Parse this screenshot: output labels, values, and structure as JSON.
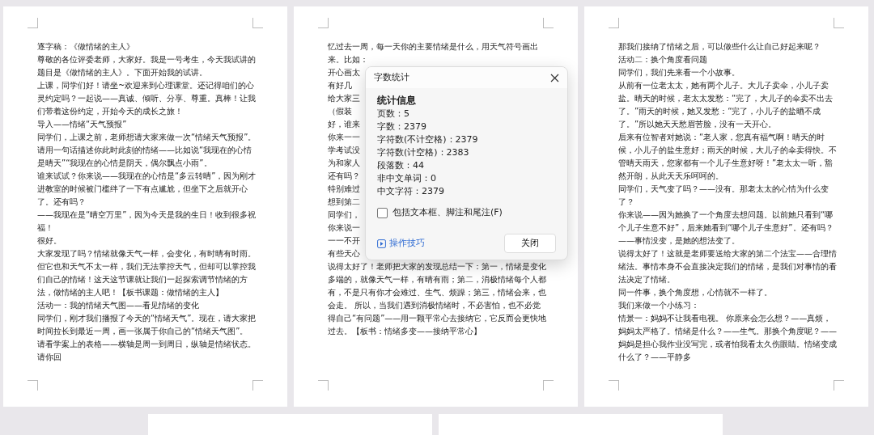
{
  "pages": [
    {
      "paragraphs": [
        "逐字稿：《做情绪的主人》",
        "尊敬的各位评委老师，大家好。我是一号考生，今天我试讲的题目是《做情绪的主人》。下面开始我的试讲。",
        "上课，同学们好！请坐~欢迎来到心理课堂。还记得咱们的心灵约定吗？一起说——真诚、倾听、分享、尊重。真棒！让我们带着这份约定，开始今天的成长之旅！",
        "导入——情绪“天气预报”",
        "同学们，上课之前，老师想请大家来做一次“情绪天气预报”。请用一句话描述你此时此刻的情绪——比如说“我现在的心情是晴天”“我现在的心情是阴天，偶尔飘点小雨”。",
        "谁来试试？你来说——我现在的心情是“多云转晴”，因为刚才进教室的时候被门槛绊了一下有点尴尬，但坐下之后就开心了。还有吗？",
        "——我现在是“晴空万里”，因为今天是我的生日！收到很多祝福！",
        "很好。",
        "大家发现了吗？情绪就像天气一样，会变化，有时晴有时雨。但它也和天气不太一样，我们无法掌控天气，但却可以掌控我们自己的情绪！这天这节课就让我们一起探索调节情绪的方法，做情绪的主人吧！【板书课题：做情绪的主人】",
        "活动一：我的情绪天气图——看见情绪的变化",
        "同学们，刚才我们播报了今天的“情绪天气”。现在，请大家把时间拉长到最近一周，画一张属于你自己的“情绪天气图”。",
        "请看学案上的表格——横轴是周一到周日，纵轴是情绪状态。请你回"
      ]
    },
    {
      "paragraphs_before": [
        "忆过去一周，每一天你的主要情绪是什么，用天气符号画出来。比如："
      ],
      "covered_lines": [
        "开心画太",
        "有好几",
        "给大家三",
        "（假装",
        "好，谁来",
        "你来一一",
        "学考试没",
        "为和家人",
        "还有吗？",
        "特别难过",
        "想到第二",
        "同学们，",
        "你来说一",
        "一一不开",
        "有些天心"
      ],
      "paragraphs": [
        "说得太好了！老师把大家的发现总结一下：第一，情绪是变化多端的，就像天气一样，有晴有雨；第二，消极情绪每个人都有，不是只有你才会难过、生气、烦躁；第三，情绪会来，也会走。 所以，当我们遇到消极情绪时，不必害怕，也不必觉得自己“有问题”——用一颗平常心去接纳它，它反而会更快地过去。【板书：情绪多变——接纳平常心】"
      ]
    },
    {
      "paragraphs": [
        "那我们接纳了情绪之后，可以做些什么让自己好起来呢？",
        "活动二：换个角度看问题",
        "同学们，我们先来看一个小故事。",
        "从前有一位老太太，她有两个儿子。大儿子卖伞，小儿子卖盐。晴天的时候，老太太发愁：“完了，大儿子的伞卖不出去了。”雨天的时候，她又发愁：“完了，小儿子的盐晒不成了。”所以她天天愁眉苦脸，没有一天开心。",
        "后来有位智者对她说：“老人家，您真有福气啊！晴天的时候，小儿子的盐生意好；雨天的时候，大儿子的伞卖得快。不管晴天雨天，您家都有一个儿子生意好呀！”老太太一听，豁然开朗，从此天天乐呵呵的。",
        "同学们，天气变了吗？——没有。那老太太的心情为什么变了？",
        "你来说——因为她换了一个角度去想问题。以前她只看到“哪个儿子生意不好”，后来她看到“哪个儿子生意好”。还有吗？——事情没变，是她的想法变了。",
        "说得太好了！这就是老师要送给大家的第二个法宝——合理情绪法。事情本身不会直接决定我们的情绪，是我们对事情的看法决定了情绪。",
        "同一件事，换个角度想，心情就不一样了。",
        "我们来做一个小练习：",
        "情景一：妈妈不让我看电视。 你原来会怎么想？——真烦，妈妈太严格了。情绪是什么？——生气。那换个角度呢？——妈妈是担心我作业没写完，或者怕我看太久伤眼睛。情绪变成什么了？——平静多"
      ]
    }
  ],
  "dialog": {
    "title": "字数统计",
    "section_title": "统计信息",
    "stats": [
      "页数：5",
      "字数：2379",
      "字符数(不计空格)：2379",
      "字符数(计空格)：2383",
      "段落数：44",
      "非中文单词：0",
      "中文字符：2379"
    ],
    "checkbox": {
      "label": "包括文本框、脚注和尾注(F)",
      "checked": false
    },
    "link": "操作技巧",
    "button": "关闭"
  }
}
